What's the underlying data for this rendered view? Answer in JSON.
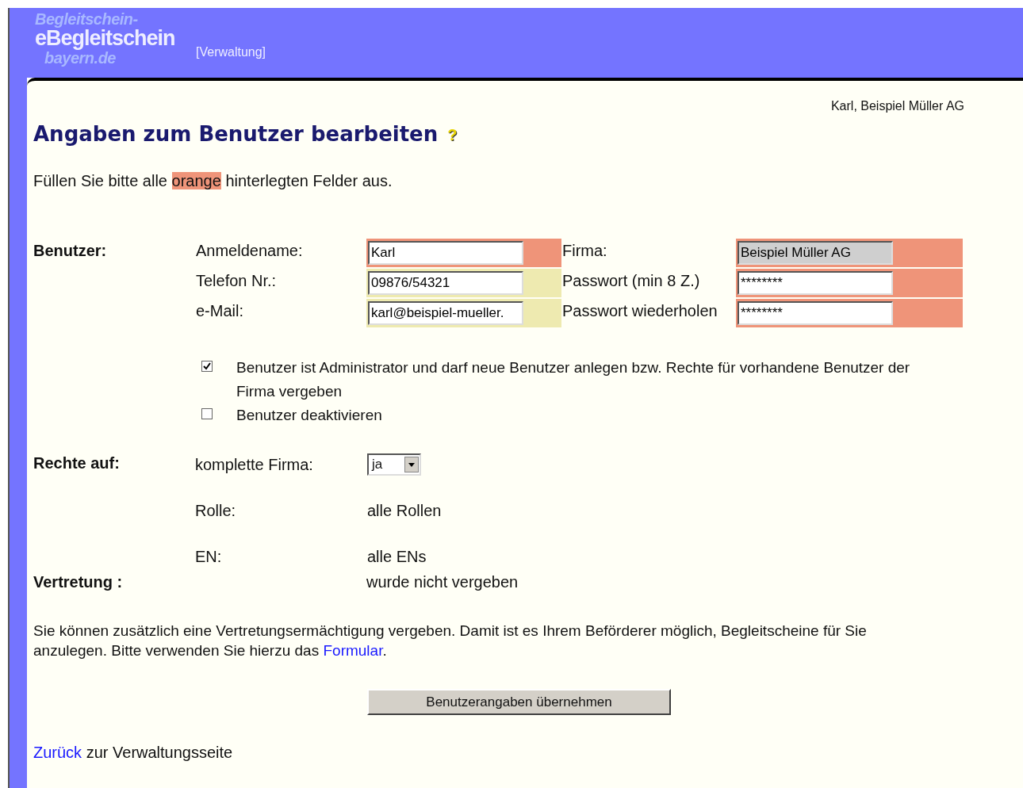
{
  "header": {
    "logo": "eBegleitschein",
    "logo_shadow": [
      "Begleitschein-",
      "bayern.de"
    ],
    "section": "[Verwaltung]"
  },
  "user_info": "Karl, Beispiel Müller AG",
  "title": "Angaben zum Benutzer bearbeiten",
  "help_icon": "?",
  "intro": {
    "before": "Füllen Sie bitte alle",
    "highlight": "orange",
    "after": "hinterlegten Felder aus."
  },
  "user_section": {
    "label": "Benutzer:",
    "fields": [
      {
        "label": "Anmeldename:",
        "value": "Karl",
        "required": true,
        "disabled": false
      },
      {
        "label": "Firma:",
        "value": "Beispiel Müller AG",
        "required": true,
        "disabled": true
      },
      {
        "label": "Telefon Nr.:",
        "value": "09876/54321",
        "required": false,
        "disabled": false
      },
      {
        "label": "Passwort (min 8 Z.)",
        "value": "********",
        "required": true,
        "disabled": false
      },
      {
        "label": "e-Mail:",
        "value": "karl@beispiel-mueller.",
        "required": false,
        "disabled": false
      },
      {
        "label": "Passwort wiederholen",
        "value": "********",
        "required": true,
        "disabled": false
      }
    ]
  },
  "options": [
    {
      "label": "Benutzer ist Administrator und darf neue Benutzer anlegen bzw. Rechte für vorhandene Benutzer der Firma vergeben",
      "checked": true
    },
    {
      "label": "Benutzer deaktivieren",
      "checked": false
    }
  ],
  "rights": {
    "label": "Rechte auf:",
    "rows": [
      {
        "label": "komplette Firma:",
        "kind": "select",
        "value": "ja"
      },
      {
        "label": "Rolle:",
        "kind": "text",
        "value": "alle Rollen"
      },
      {
        "label": "EN:",
        "kind": "text",
        "value": "alle ENs"
      }
    ]
  },
  "representation": {
    "label": "Vertretung :",
    "value": "wurde nicht vergeben"
  },
  "note": {
    "text": "Sie können zusätzlich eine Vertretungsermächtigung vergeben. Damit ist es Ihrem Beförderer möglich, Begleitscheine für Sie anzulegen. Bitte verwenden Sie hierzu das",
    "link": "Formular",
    "after": "."
  },
  "submit": "Benutzerangaben übernehmen",
  "back": {
    "link": "Zurück",
    "text": "zur Verwaltungsseite"
  }
}
